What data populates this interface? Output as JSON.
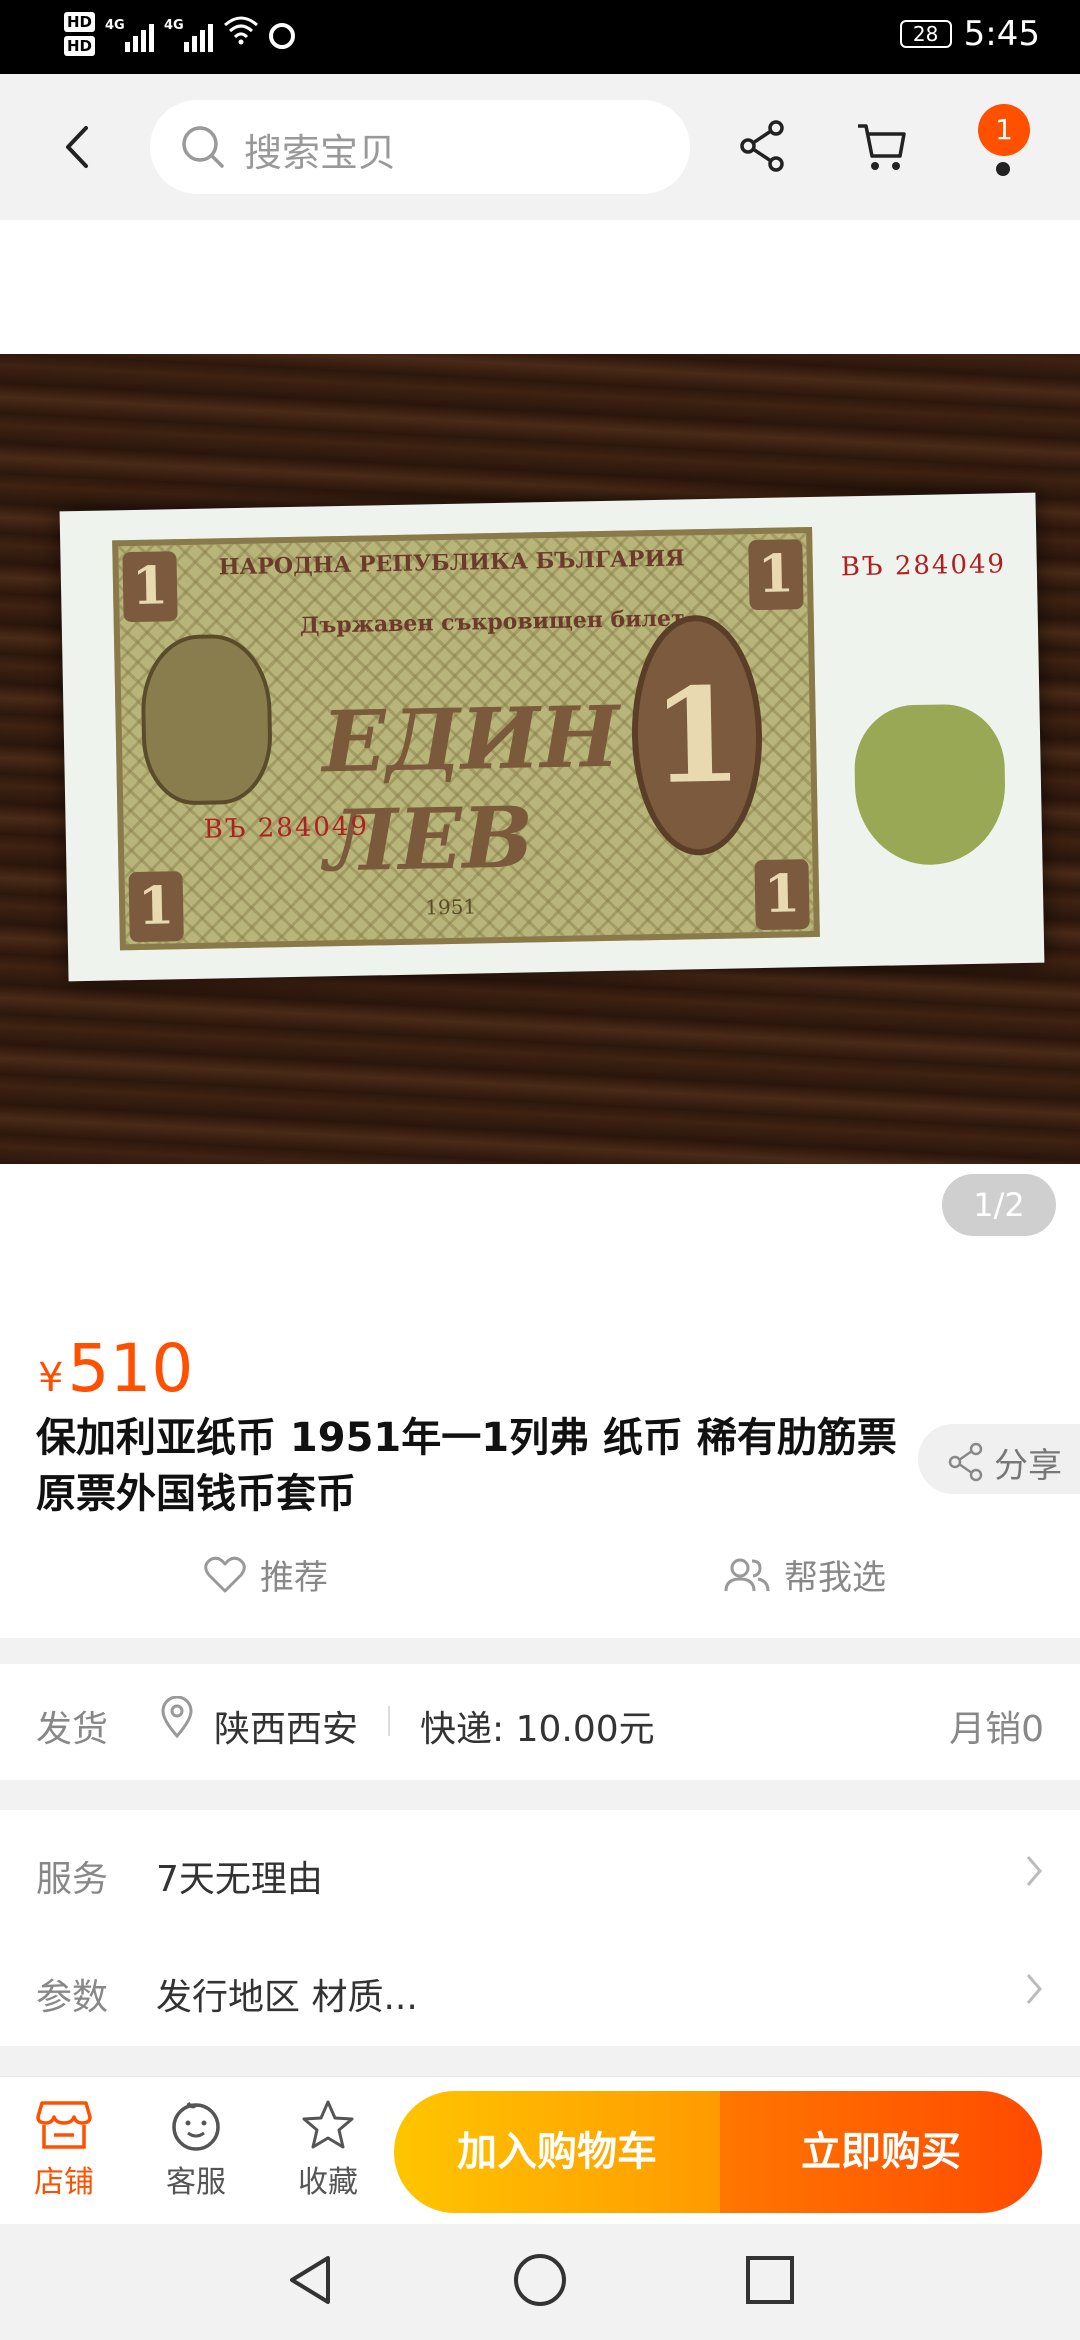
{
  "status_bar": {
    "hd1": "HD",
    "hd2": "HD",
    "net1": "4G",
    "net2": "4G",
    "battery": "28",
    "time": "5:45"
  },
  "header": {
    "search_placeholder": "搜索宝贝",
    "cart_badge": "1"
  },
  "gallery": {
    "pager": "1/2",
    "banknote": {
      "top_text": "НАРОДНА РЕПУБЛИКА БЪЛГАРИЯ",
      "sub_text": "Държавен съкровищен билет",
      "big_text": "ЕДИН ЛЕВ",
      "serial": "ВЪ 284049",
      "denomination": "1",
      "year": "1951"
    }
  },
  "product": {
    "currency": "¥",
    "price": "510",
    "title": "保加利亚纸币 1951年一1列弗 纸币 稀有肋筋票 原票外国钱币套币",
    "share_label": "分享",
    "recommend_label": "推荐",
    "help_choose_label": "帮我选"
  },
  "delivery": {
    "label": "发货",
    "location": "陕西西安",
    "shipping": "快递: 10.00元",
    "monthly_sales": "月销0"
  },
  "service": {
    "label": "服务",
    "value": "7天无理由"
  },
  "params": {
    "label": "参数",
    "value": "发行地区 材质..."
  },
  "bottom_bar": {
    "shop_label": "店铺",
    "service_label": "客服",
    "favorite_label": "收藏",
    "add_cart_label": "加入购物车",
    "buy_now_label": "立即购买"
  },
  "colors": {
    "accent": "#ff5000",
    "cart_gradient_start": "#ffc500",
    "buy_gradient_end": "#ff4a00"
  }
}
